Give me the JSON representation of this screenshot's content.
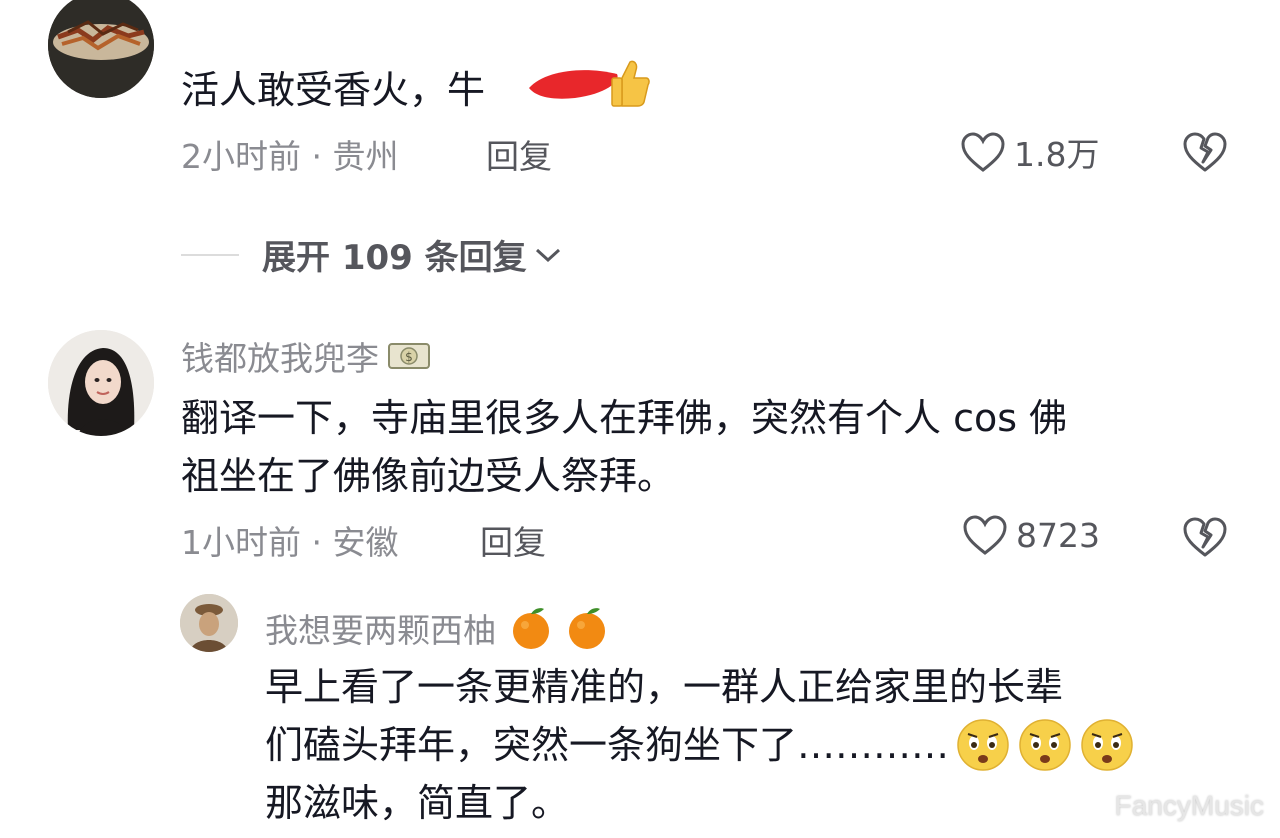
{
  "comments": [
    {
      "text": "活人敢受香火，牛",
      "meta": "2小时前 · 贵州",
      "reply_label": "回复",
      "likes": "1.8万"
    },
    {
      "username": "钱都放我兜李",
      "username_badge_icon": "money-icon",
      "text_line1": "翻译一下，寺庙里很多人在拜佛，突然有个人 cos 佛",
      "text_line2": "祖坐在了佛像前边受人祭拜。",
      "meta": "1小时前 · 安徽",
      "reply_label": "回复",
      "likes": "8723"
    }
  ],
  "expand_replies": {
    "label": "展开 109 条回复",
    "icon": "chevron-down-icon"
  },
  "reply": {
    "username": "我想要两颗西柚",
    "username_emoji": [
      "orange-emoji",
      "orange-emoji"
    ],
    "text_line1": "早上看了一条更精准的，一群人正给家里的长辈",
    "text_line2": "们磕头拜年，突然一条狗坐下了…………",
    "text_line2_emoji": [
      "crying-face-emoji",
      "crying-face-emoji",
      "crying-face-emoji"
    ],
    "text_line3": "那滋味，简直了。"
  },
  "watermark": "FancyMusic",
  "colors": {
    "text_primary": "#161823",
    "text_secondary": "#8a8b91",
    "redaction": "#e8272b",
    "thumbs_up": "#f6c445"
  }
}
